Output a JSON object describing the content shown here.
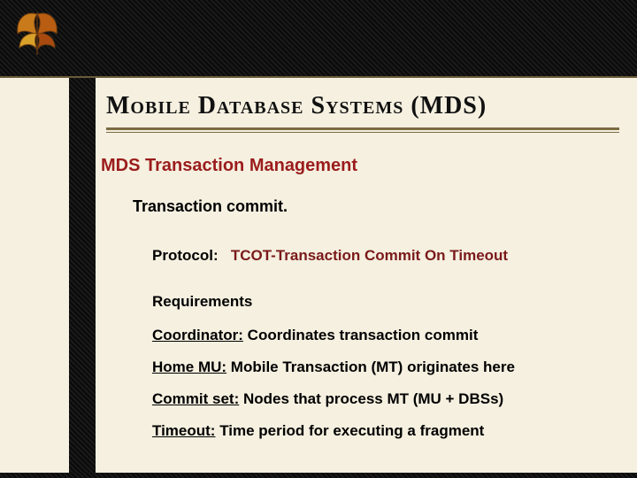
{
  "slide": {
    "title": "Mobile Database Systems (MDS)",
    "section_heading": "MDS Transaction Management",
    "subheading": "Transaction commit.",
    "protocol": {
      "label": "Protocol:",
      "value": "TCOT-Transaction Commit On Timeout"
    },
    "requirements_heading": "Requirements",
    "definitions": [
      {
        "term": "Coordinator:",
        "text": " Coordinates transaction commit"
      },
      {
        "term": "Home MU:",
        "text": " Mobile Transaction (MT) originates here"
      },
      {
        "term": "Commit set:",
        "text": " Nodes that process MT (MU + DBSs)"
      },
      {
        "term": "Timeout:",
        "text": " Time period for executing a fragment"
      }
    ]
  }
}
